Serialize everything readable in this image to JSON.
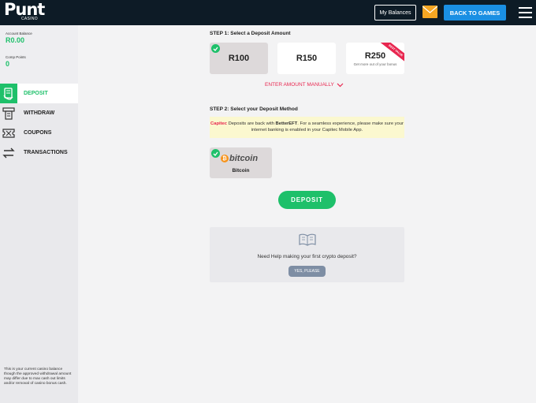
{
  "header": {
    "logo_text": "Punt",
    "logo_sub": "CASINO",
    "balances_label": "My Balances",
    "back_label": "BACK TO GAMES",
    "icons": [
      "mail-icon",
      "hamburger-menu-icon"
    ]
  },
  "sidebar": {
    "account_balance_label": "Account Balance",
    "account_balance_value": "R0.00",
    "comp_points_label": "Comp Points",
    "comp_points_value": "0",
    "items": [
      {
        "label": "DEPOSIT",
        "icon": "deposit-icon",
        "active": true
      },
      {
        "label": "WITHDRAW",
        "icon": "withdraw-icon",
        "active": false
      },
      {
        "label": "COUPONS",
        "icon": "coupon-icon",
        "active": false
      },
      {
        "label": "TRANSACTIONS",
        "icon": "transactions-icon",
        "active": false
      }
    ],
    "note": "This is your current casino balance though the approved withdrawal amount may differ due to max cash out limits and/or removal of casino bonus cash."
  },
  "main": {
    "step1_title": "STEP 1: Select a Deposit Amount",
    "amounts": [
      {
        "value": "R100",
        "selected": true
      },
      {
        "value": "R150",
        "selected": false
      },
      {
        "value": "R250",
        "selected": false,
        "subtext": "Get more out of your bonus",
        "ribbon": "BEST VALUE"
      }
    ],
    "enter_manually": "ENTER AMOUNT MANUALLY",
    "step2_title": "STEP 2: Select your Deposit Method",
    "notice": {
      "brand": "Capitec",
      "text_before": " Deposits are back with ",
      "highlight": "BetterEFT",
      "text_after": ". For a seamless experience, please make sure your internet banking is enabled in your Capitec Mobile App."
    },
    "method": {
      "logo_text": "bitcoin",
      "label": "Bitcoin",
      "selected": true
    },
    "deposit_button": "DEPOSIT",
    "help": {
      "text": "Need Help making your first crypto deposit?",
      "button": "YES, PLEASE"
    }
  },
  "colors": {
    "accent_green": "#1ec06a",
    "header_bg": "#0d1b26",
    "button_blue": "#1a8fe3",
    "red": "#e8264f",
    "bitcoin_orange": "#f7931a"
  }
}
